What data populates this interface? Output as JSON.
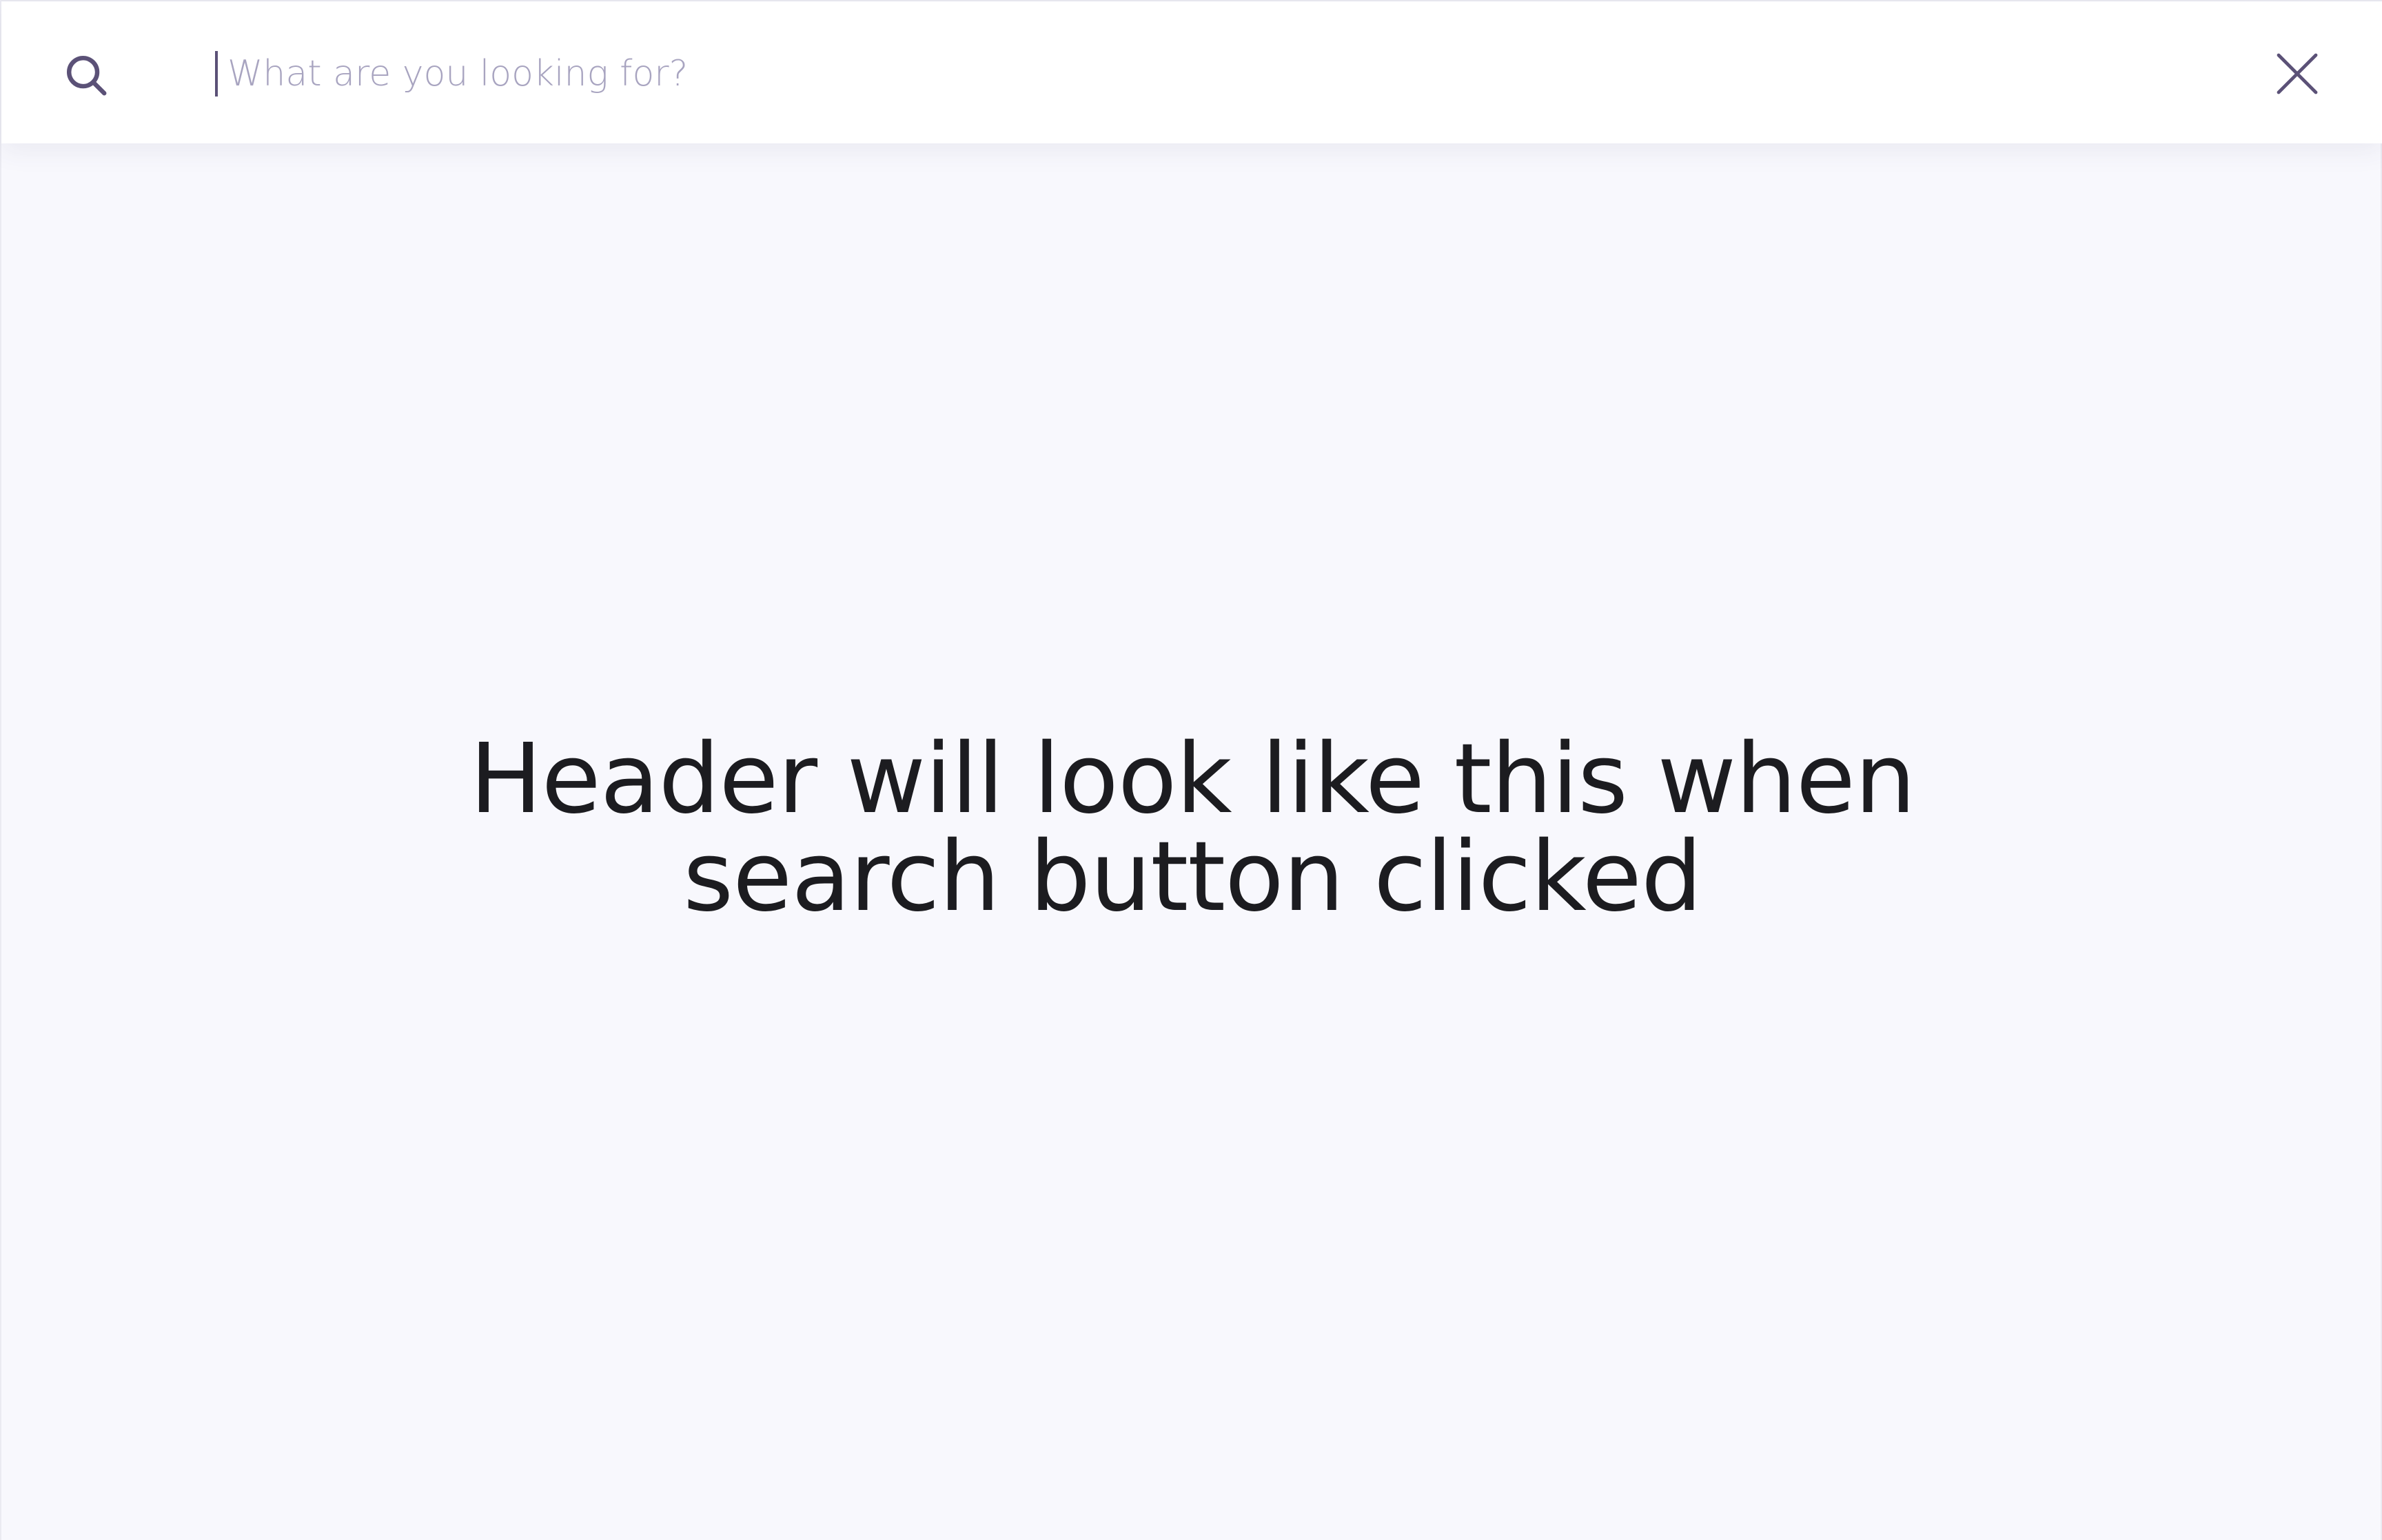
{
  "search": {
    "placeholder": "What are you looking for?",
    "value": "",
    "icon": "search-icon",
    "close_icon": "close-icon"
  },
  "message": {
    "line1": "Header will look like this when",
    "line2": "search button clicked"
  },
  "colors": {
    "background": "#f8f8fd",
    "header": "#ffffff",
    "icon": "#5b5177",
    "placeholder": "#a8a4c0",
    "text": "#1c1c20"
  }
}
